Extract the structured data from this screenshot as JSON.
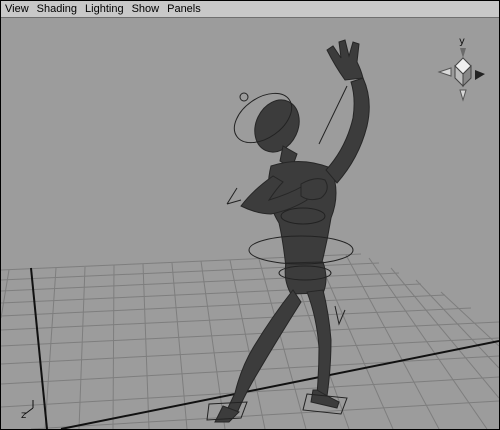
{
  "menubar": {
    "items": [
      {
        "label": "View"
      },
      {
        "label": "Shading"
      },
      {
        "label": "Lighting"
      },
      {
        "label": "Show"
      },
      {
        "label": "Panels"
      }
    ]
  },
  "view_cube": {
    "axis_up": "y"
  },
  "origin_axes": {
    "label": "z"
  },
  "colors": {
    "viewport_bg": "#9c9c9c",
    "grid_line": "#7e7e7e",
    "grid_axis": "#111111",
    "character": "#3c3c3c",
    "menubar_bg": "#c8c8c8"
  },
  "icons": [
    "view-cube-icon",
    "origin-axes-icon"
  ]
}
